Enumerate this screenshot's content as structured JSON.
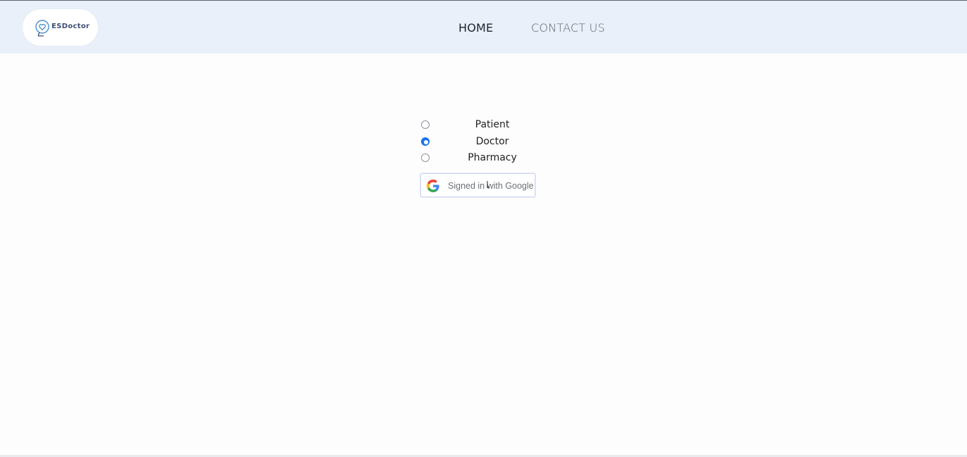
{
  "header": {
    "logo_text": "ESDoctor",
    "logo_icon": "heart-map-pin-icon",
    "nav": [
      {
        "label": "HOME"
      },
      {
        "label": "CONTACT US"
      }
    ],
    "background": "#e9f0fa"
  },
  "role_selector": {
    "options": [
      {
        "label": "Patient",
        "checked": false
      },
      {
        "label": "Doctor",
        "checked": true
      },
      {
        "label": "Pharmacy",
        "checked": false
      }
    ],
    "accent": "#1a73e8"
  },
  "google_button": {
    "label": "Signed in with Google",
    "icon": "google-g-icon"
  }
}
